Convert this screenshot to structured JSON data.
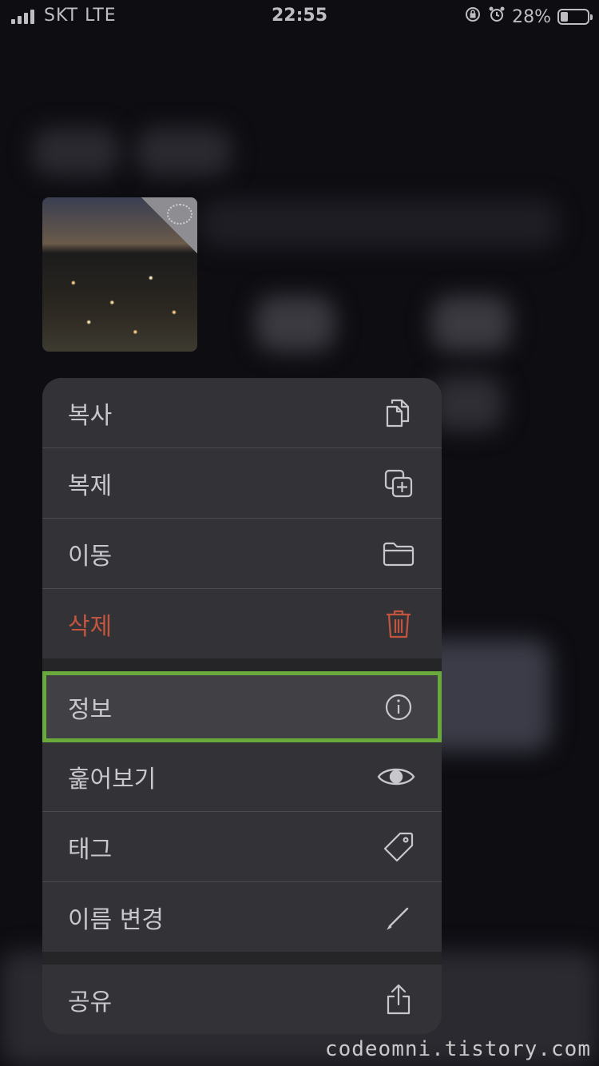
{
  "status_bar": {
    "carrier": "SKT  LTE",
    "time": "22:55",
    "battery_percent": "28%",
    "battery_level": 0.28
  },
  "thumbnail": {
    "icon": "photo-thumbnail"
  },
  "menu": {
    "items": [
      {
        "label": "복사",
        "icon": "copy-icon"
      },
      {
        "label": "복제",
        "icon": "duplicate-icon"
      },
      {
        "label": "이동",
        "icon": "folder-icon"
      },
      {
        "label": "삭제",
        "icon": "trash-icon",
        "color": "#c3553f"
      },
      {
        "label": "정보",
        "icon": "info-icon",
        "highlight_color": "#6aa93c"
      },
      {
        "label": "훑어보기",
        "icon": "eye-icon"
      },
      {
        "label": "태그",
        "icon": "tag-icon"
      },
      {
        "label": "이름 변경",
        "icon": "pencil-icon"
      },
      {
        "label": "공유",
        "icon": "share-icon"
      }
    ]
  },
  "watermark": "codeomni.tistory.com"
}
